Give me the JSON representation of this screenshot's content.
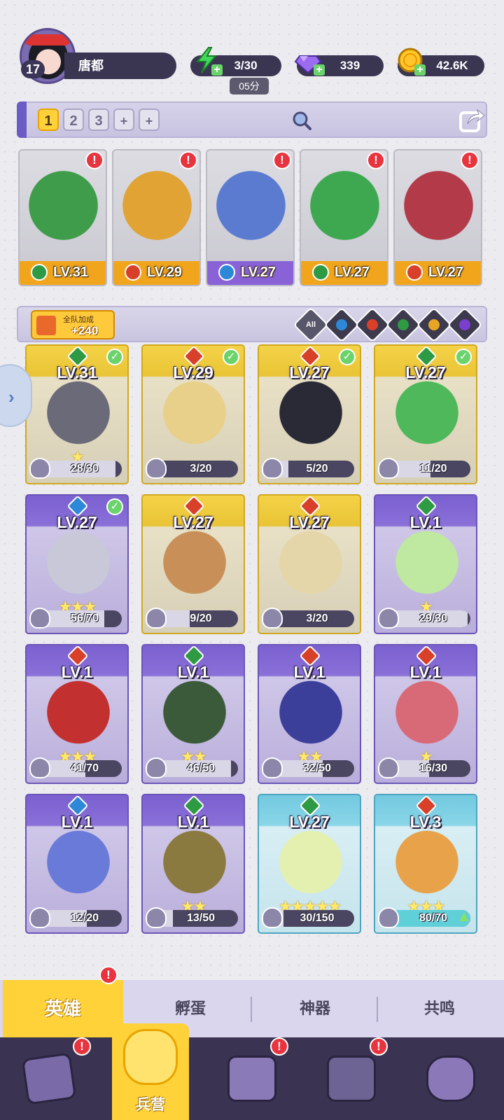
{
  "player": {
    "level": "17",
    "name": "唐都"
  },
  "resources": {
    "energy": "3/30",
    "energy_timer": "05分",
    "gems": "339",
    "coins": "42.6K"
  },
  "team_tabs": {
    "numbers": [
      "1",
      "2",
      "3"
    ],
    "add": [
      "+",
      "+"
    ],
    "active_index": 0
  },
  "team_slots": [
    {
      "level": "LV.31",
      "element": "wind",
      "color": "#3e9c4b"
    },
    {
      "level": "LV.29",
      "element": "fire",
      "color": "#e0a334"
    },
    {
      "level": "LV.27",
      "element": "water",
      "color": "#5a7bd0"
    },
    {
      "level": "LV.27",
      "element": "wind",
      "color": "#3ea851"
    },
    {
      "level": "LV.27",
      "element": "fire",
      "color": "#b33a48"
    }
  ],
  "bonus": {
    "label": "全队加成",
    "value": "+240"
  },
  "filters": {
    "all_label": "All"
  },
  "heroes": [
    {
      "level": "LV.31",
      "frame": "gold",
      "element": "wind",
      "stars": "★",
      "shards": "28/30",
      "progress": 0.93,
      "checked": true,
      "art": "#6a6a78"
    },
    {
      "level": "LV.29",
      "frame": "gold",
      "element": "fire",
      "stars": "",
      "shards": "3/20",
      "progress": 0.15,
      "checked": true,
      "art": "#e8cf8a"
    },
    {
      "level": "LV.27",
      "frame": "gold",
      "element": "fire",
      "stars": "",
      "shards": "5/20",
      "progress": 0.25,
      "checked": true,
      "art": "#2a2a36"
    },
    {
      "level": "LV.27",
      "frame": "gold",
      "element": "wind",
      "stars": "",
      "shards": "11/20",
      "progress": 0.55,
      "checked": true,
      "art": "#4fb85a"
    },
    {
      "level": "LV.27",
      "frame": "purple",
      "element": "water",
      "stars": "★★★",
      "shards": "56/70",
      "progress": 0.8,
      "checked": true,
      "art": "#c8c8d8"
    },
    {
      "level": "LV.27",
      "frame": "gold",
      "element": "fire",
      "stars": "",
      "shards": "9/20",
      "progress": 0.45,
      "checked": false,
      "art": "#c89058"
    },
    {
      "level": "LV.27",
      "frame": "gold",
      "element": "fire",
      "stars": "",
      "shards": "3/20",
      "progress": 0.15,
      "checked": false,
      "art": "#e4d6a8"
    },
    {
      "level": "LV.1",
      "frame": "purple",
      "element": "wind",
      "stars": "★",
      "shards": "29/30",
      "progress": 0.97,
      "checked": false,
      "art": "#bfe8a0"
    },
    {
      "level": "LV.1",
      "frame": "purple",
      "element": "fire",
      "stars": "★★★",
      "shards": "41/70",
      "progress": 0.59,
      "checked": false,
      "art": "#c23030"
    },
    {
      "level": "LV.1",
      "frame": "purple",
      "element": "wind",
      "stars": "★★",
      "shards": "46/50",
      "progress": 0.92,
      "checked": false,
      "art": "#3a5a3a"
    },
    {
      "level": "LV.1",
      "frame": "purple",
      "element": "fire",
      "stars": "★★",
      "shards": "32/50",
      "progress": 0.64,
      "checked": false,
      "art": "#3b3f9a"
    },
    {
      "level": "LV.1",
      "frame": "purple",
      "element": "fire",
      "stars": "★",
      "shards": "16/30",
      "progress": 0.53,
      "checked": false,
      "art": "#d86a78"
    },
    {
      "level": "LV.1",
      "frame": "purple",
      "element": "water",
      "stars": "",
      "shards": "12/20",
      "progress": 0.6,
      "checked": false,
      "art": "#6a7ad8"
    },
    {
      "level": "LV.1",
      "frame": "purple",
      "element": "wind",
      "stars": "★★",
      "shards": "13/50",
      "progress": 0.26,
      "checked": false,
      "art": "#8a7a40"
    },
    {
      "level": "LV.27",
      "frame": "teal",
      "element": "wind",
      "stars": "★★★★★",
      "shards": "30/150",
      "progress": 0.2,
      "checked": false,
      "art": "#e4f0b0"
    },
    {
      "level": "LV.3",
      "frame": "teal",
      "element": "fire",
      "stars": "★★★",
      "shards": "80/70",
      "progress": 1.0,
      "checked": false,
      "upgrade": true,
      "art": "#e8a24a"
    }
  ],
  "sub_tabs": [
    "英雄",
    "孵蛋",
    "神器",
    "共鸣"
  ],
  "nav": {
    "center_label": "兵营"
  },
  "element_colors": {
    "wind": "#2f9a44",
    "fire": "#d8402a",
    "water": "#2e88d8",
    "light": "#e8a524",
    "dark": "#7a3ed0"
  }
}
